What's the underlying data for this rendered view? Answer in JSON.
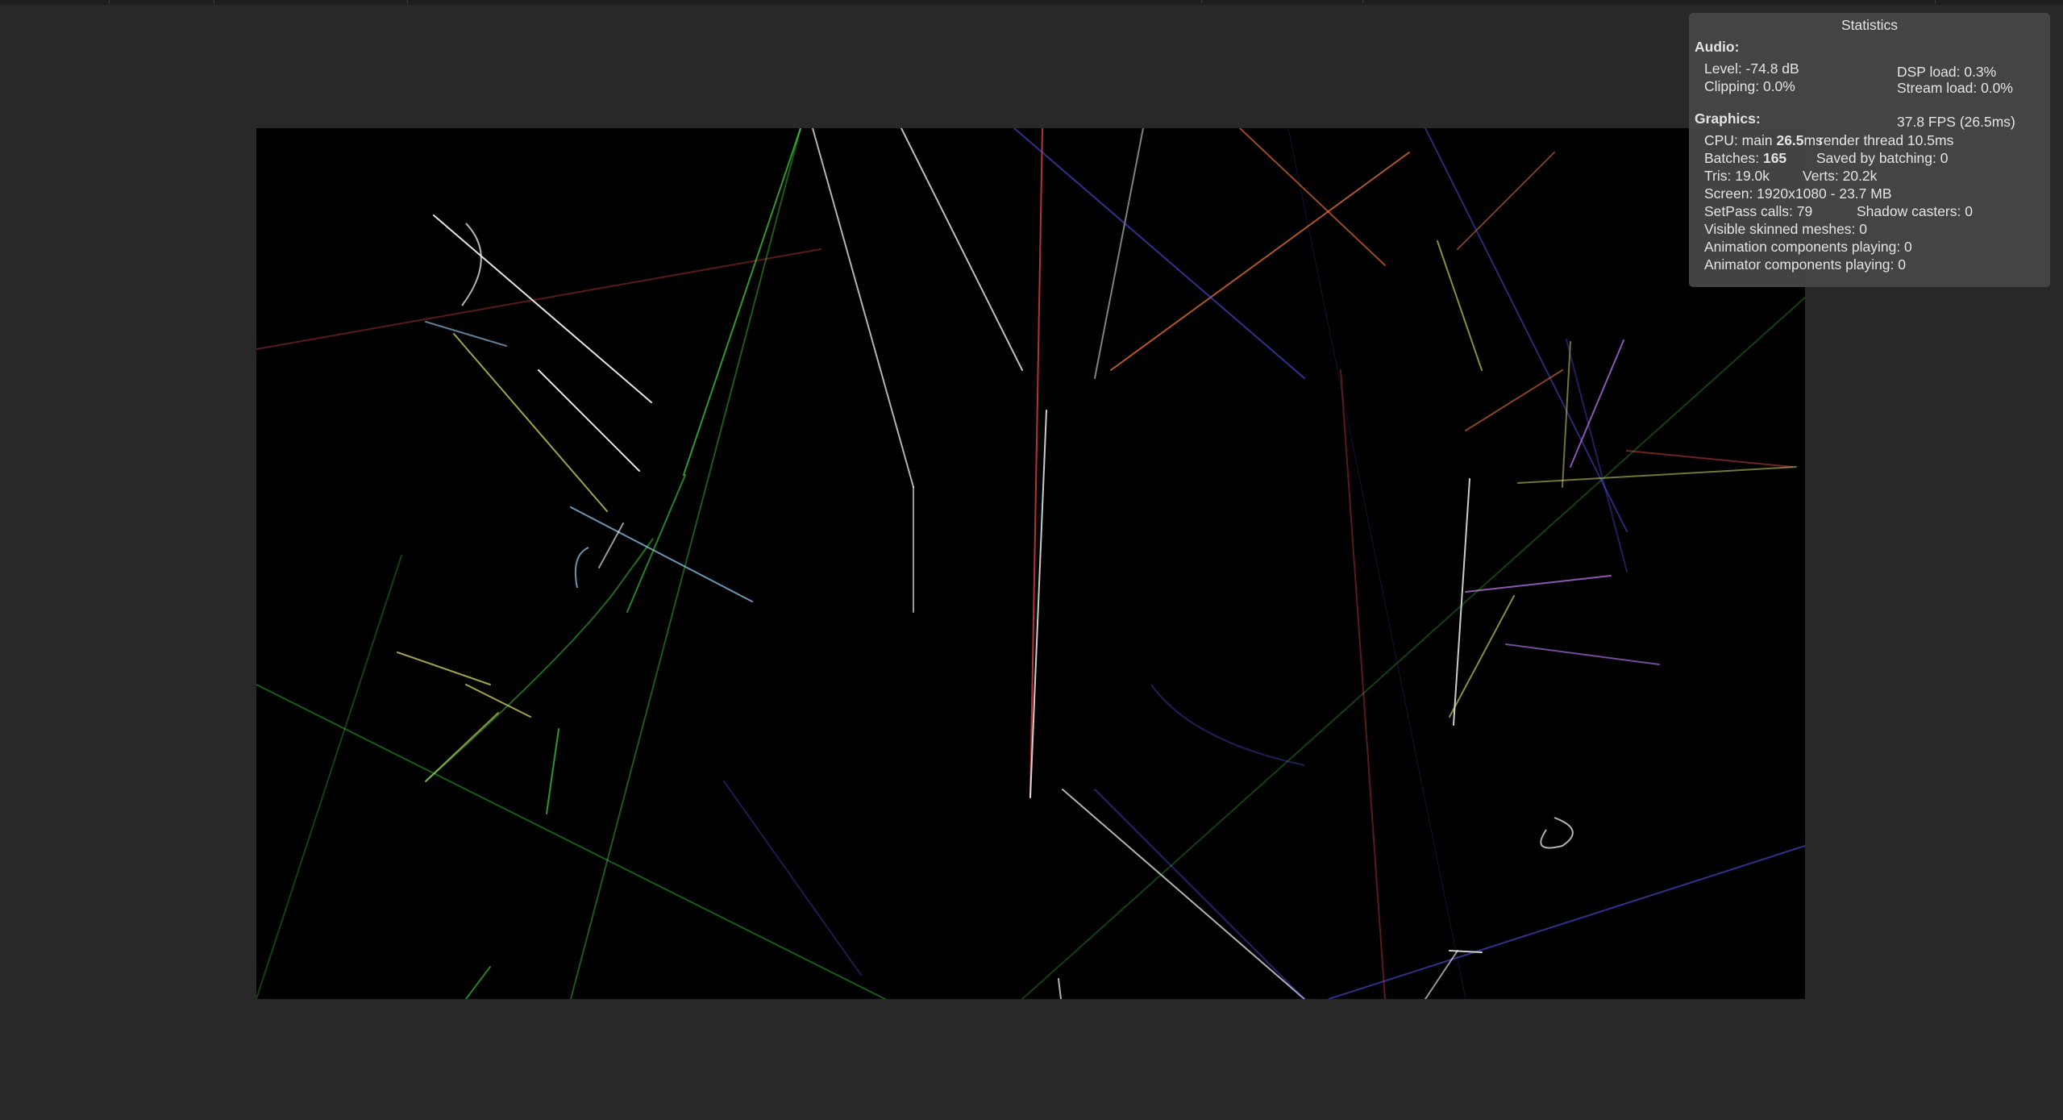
{
  "statistics": {
    "title": "Statistics",
    "audio": {
      "header": "Audio:",
      "level": "Level: -74.8 dB",
      "clipping": "Clipping: 0.0%",
      "dsp_load": "DSP load: 0.3%",
      "stream_load": "Stream load: 0.0%"
    },
    "graphics": {
      "header": "Graphics:",
      "fps": "37.8 FPS (26.5ms)",
      "cpu_label": "CPU: main ",
      "cpu_main_value": "26.5",
      "cpu_unit": "ms",
      "render_thread": "render thread 10.5ms",
      "batches_label": "Batches: ",
      "batches_value": "165",
      "saved_by_batching": "Saved by batching: 0",
      "tris": "Tris: 19.0k",
      "verts": "Verts: 20.2k",
      "screen": "Screen: 1920x1080 - 23.7 MB",
      "setpass_calls": "SetPass calls: 79",
      "shadow_casters": "Shadow casters: 0",
      "visible_skinned_meshes": "Visible skinned meshes: 0",
      "animation_components": "Animation components playing: 0",
      "animator_components": "Animator components playing: 0"
    }
  },
  "game_view": {
    "background": "#000000",
    "trail_colors": [
      "#ffffff",
      "#ff4a4a",
      "#5a5aff",
      "#4fff4f",
      "#e8e86a",
      "#9ad4ff",
      "#c87aff",
      "#ff7a3a"
    ]
  }
}
